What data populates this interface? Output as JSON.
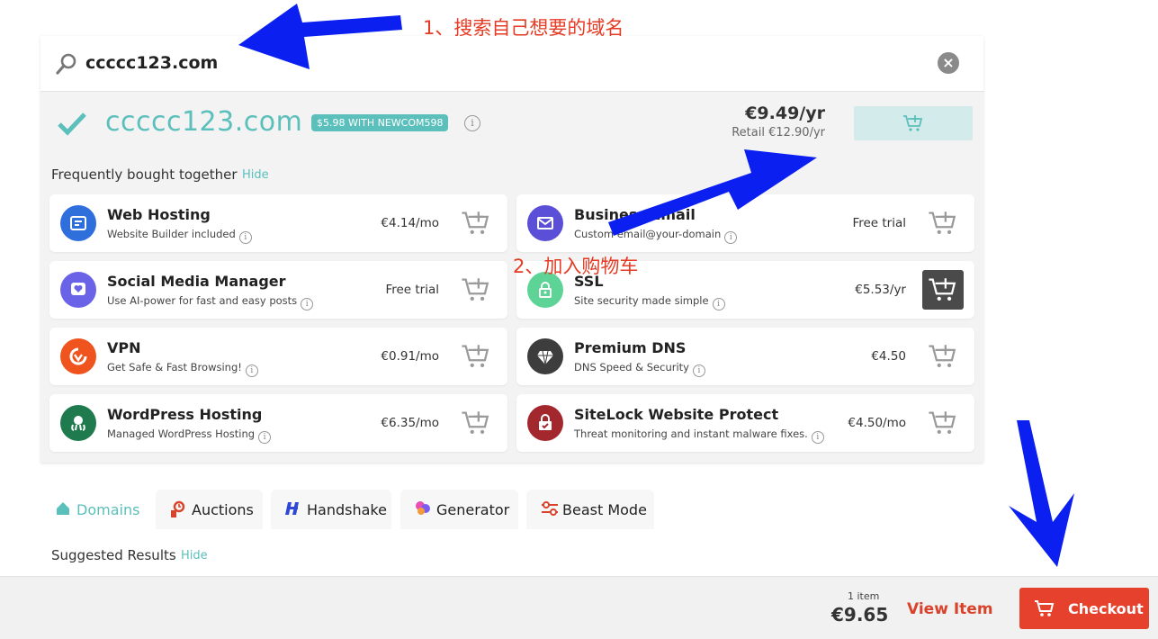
{
  "search": {
    "value": "ccccc123.com"
  },
  "result": {
    "domain": "ccccc123.com",
    "promo": "$5.98 WITH NEWCOM598",
    "price": "€9.49/yr",
    "retail": "Retail €12.90/yr"
  },
  "fbt": {
    "label": "Frequently bought together",
    "hide": "Hide",
    "items": [
      {
        "title": "Web Hosting",
        "sub": "Website Builder included",
        "price": "€4.14/mo",
        "icon": "web-hosting-icon",
        "color": "#2f6fdb"
      },
      {
        "title": "Business Email",
        "sub": "Custom email@your-domain",
        "price": "Free trial",
        "icon": "envelope-icon",
        "color": "#5b4fd8"
      },
      {
        "title": "Social Media Manager",
        "sub": "Use AI-power for fast and easy posts",
        "price": "Free trial",
        "icon": "heart-chat-icon",
        "color": "#6a63e8"
      },
      {
        "title": "SSL",
        "sub": "Site security made simple",
        "price": "€5.53/yr",
        "icon": "padlock-icon",
        "color": "#5dd495"
      },
      {
        "title": "VPN",
        "sub": "Get Safe & Fast Browsing!",
        "price": "€0.91/mo",
        "icon": "vpn-icon",
        "color": "#f0541e"
      },
      {
        "title": "Premium DNS",
        "sub": "DNS Speed & Security",
        "price": "€4.50",
        "icon": "diamond-icon",
        "color": "#3d3d3d"
      },
      {
        "title": "WordPress Hosting",
        "sub": "Managed WordPress Hosting",
        "price": "€6.35/mo",
        "icon": "octopus-icon",
        "color": "#1f7a4d"
      },
      {
        "title": "SiteLock Website Protect",
        "sub": "Threat monitoring and instant malware fixes.",
        "price": "€4.50/mo",
        "icon": "sitelock-icon",
        "color": "#a3282d"
      }
    ]
  },
  "tabs": [
    {
      "label": "Domains",
      "icon": "house-icon"
    },
    {
      "label": "Auctions",
      "icon": "auction-icon"
    },
    {
      "label": "Handshake",
      "icon": "handshake-icon"
    },
    {
      "label": "Generator",
      "icon": "generator-icon"
    },
    {
      "label": "Beast Mode",
      "icon": "sliders-icon"
    }
  ],
  "suggested": {
    "label": "Suggested Results",
    "hide": "Hide"
  },
  "footer": {
    "item_count": "1 item",
    "total": "€9.65",
    "view_item": "View Item",
    "checkout": "Checkout"
  },
  "annotations": {
    "step1": "1、搜索自己想要的域名",
    "step2": "2、加入购物车"
  },
  "colors": {
    "accent": "#5bbfbb",
    "checkout": "#e5412d",
    "annotation": "#e53b24",
    "arrow": "#0a1ff0"
  }
}
